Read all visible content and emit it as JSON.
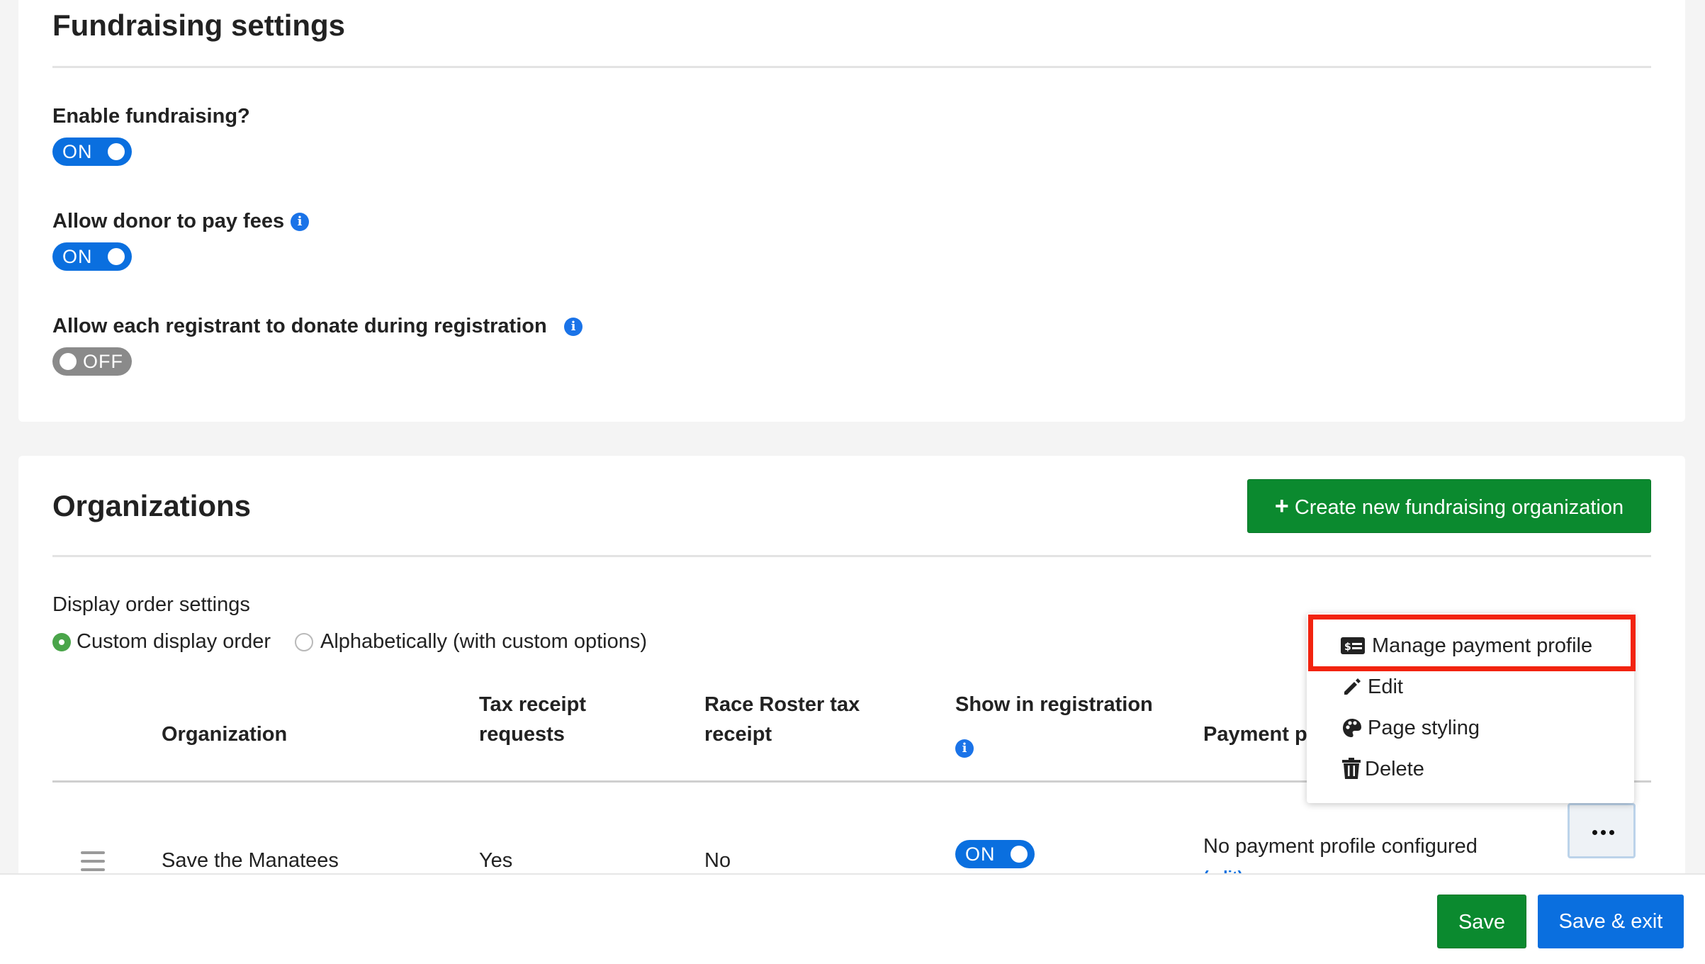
{
  "fundraising": {
    "title": "Fundraising settings",
    "enable_label": "Enable fundraising?",
    "enable_state": "ON",
    "donor_fees_label": "Allow donor to pay fees",
    "donor_fees_state": "ON",
    "donate_during_reg_label": "Allow each registrant to donate during registration",
    "donate_during_reg_state": "OFF"
  },
  "organizations": {
    "title": "Organizations",
    "create_button": "Create new fundraising organization",
    "display_order_title": "Display order settings",
    "display_order_options": [
      "Custom display order",
      "Alphabetically (with custom options)"
    ],
    "display_order_selected": "Custom display order",
    "table": {
      "headers": {
        "organization": "Organization",
        "tax_receipt_line1": "Tax receipt",
        "tax_receipt_line2": "requests",
        "rr_tax_line1": "Race Roster tax",
        "rr_tax_line2": "receipt",
        "show_in_reg": "Show in registration",
        "payment_profile_partial": "Payment pı"
      },
      "rows": [
        {
          "organization": "Save the Manatees",
          "tax_receipt_requests": "Yes",
          "race_roster_tax_receipt": "No",
          "show_in_registration": "ON",
          "payment_profile": "No payment profile configured",
          "payment_profile_link": "(edit)"
        }
      ]
    }
  },
  "menu": {
    "items": [
      "Manage payment profile",
      "Edit",
      "Page styling",
      "Delete"
    ]
  },
  "footer": {
    "save": "Save",
    "save_exit": "Save & exit"
  },
  "colors": {
    "primary_blue": "#0a6fdf",
    "success_green": "#0b8a2f",
    "highlight_red": "#f2230f",
    "toggle_off_gray": "#8a8a8a"
  }
}
